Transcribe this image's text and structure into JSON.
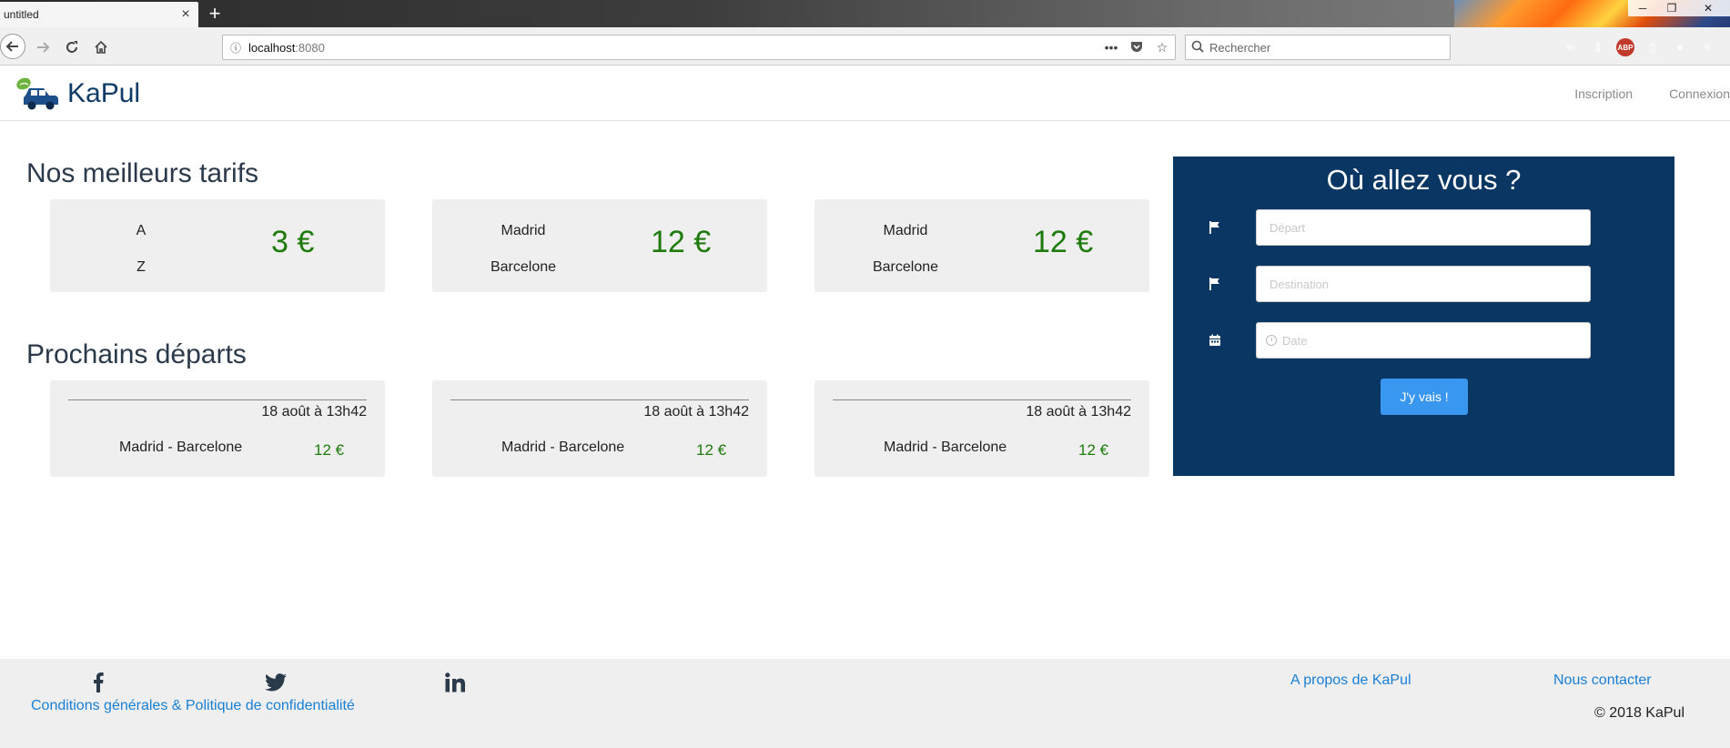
{
  "browser": {
    "tab_title": "untitled",
    "tab_close": "×",
    "new_tab": "+",
    "url_host": "localhost",
    "url_port": ":8080",
    "search_placeholder": "Rechercher",
    "menu_dots": "•••",
    "ext_abp_label": "ABP"
  },
  "navbar": {
    "brand": "KaPul",
    "links": [
      "Inscription",
      "Connexion"
    ]
  },
  "tarifs": {
    "title": "Nos meilleurs tarifs",
    "cards": [
      {
        "from": "A",
        "to": "Z",
        "price": "3 €"
      },
      {
        "from": "Madrid",
        "to": "Barcelone",
        "price": "12 €"
      },
      {
        "from": "Madrid",
        "to": "Barcelone",
        "price": "12 €"
      }
    ]
  },
  "departs": {
    "title": "Prochains départs",
    "cards": [
      {
        "date": "18 août à 13h42",
        "route": "Madrid - Barcelone",
        "price": "12 €"
      },
      {
        "date": "18 août à 13h42",
        "route": "Madrid - Barcelone",
        "price": "12 €"
      },
      {
        "date": "18 août à 13h42",
        "route": "Madrid - Barcelone",
        "price": "12 €"
      }
    ]
  },
  "search": {
    "title": "Où allez vous ?",
    "depart_placeholder": "Départ",
    "destination_placeholder": "Destination",
    "date_placeholder": "Date",
    "submit": "J'y vais !"
  },
  "footer": {
    "conditions": "Conditions générales & Politique de confidentialité",
    "about": "A propos de KaPul",
    "contact": "Nous contacter",
    "copyright": "© 2018 KaPul"
  },
  "colors": {
    "panel_bg": "#0a3664",
    "price_green": "#1e7b0b",
    "link_blue": "#1a7fd4",
    "button_blue": "#3a97f0"
  }
}
